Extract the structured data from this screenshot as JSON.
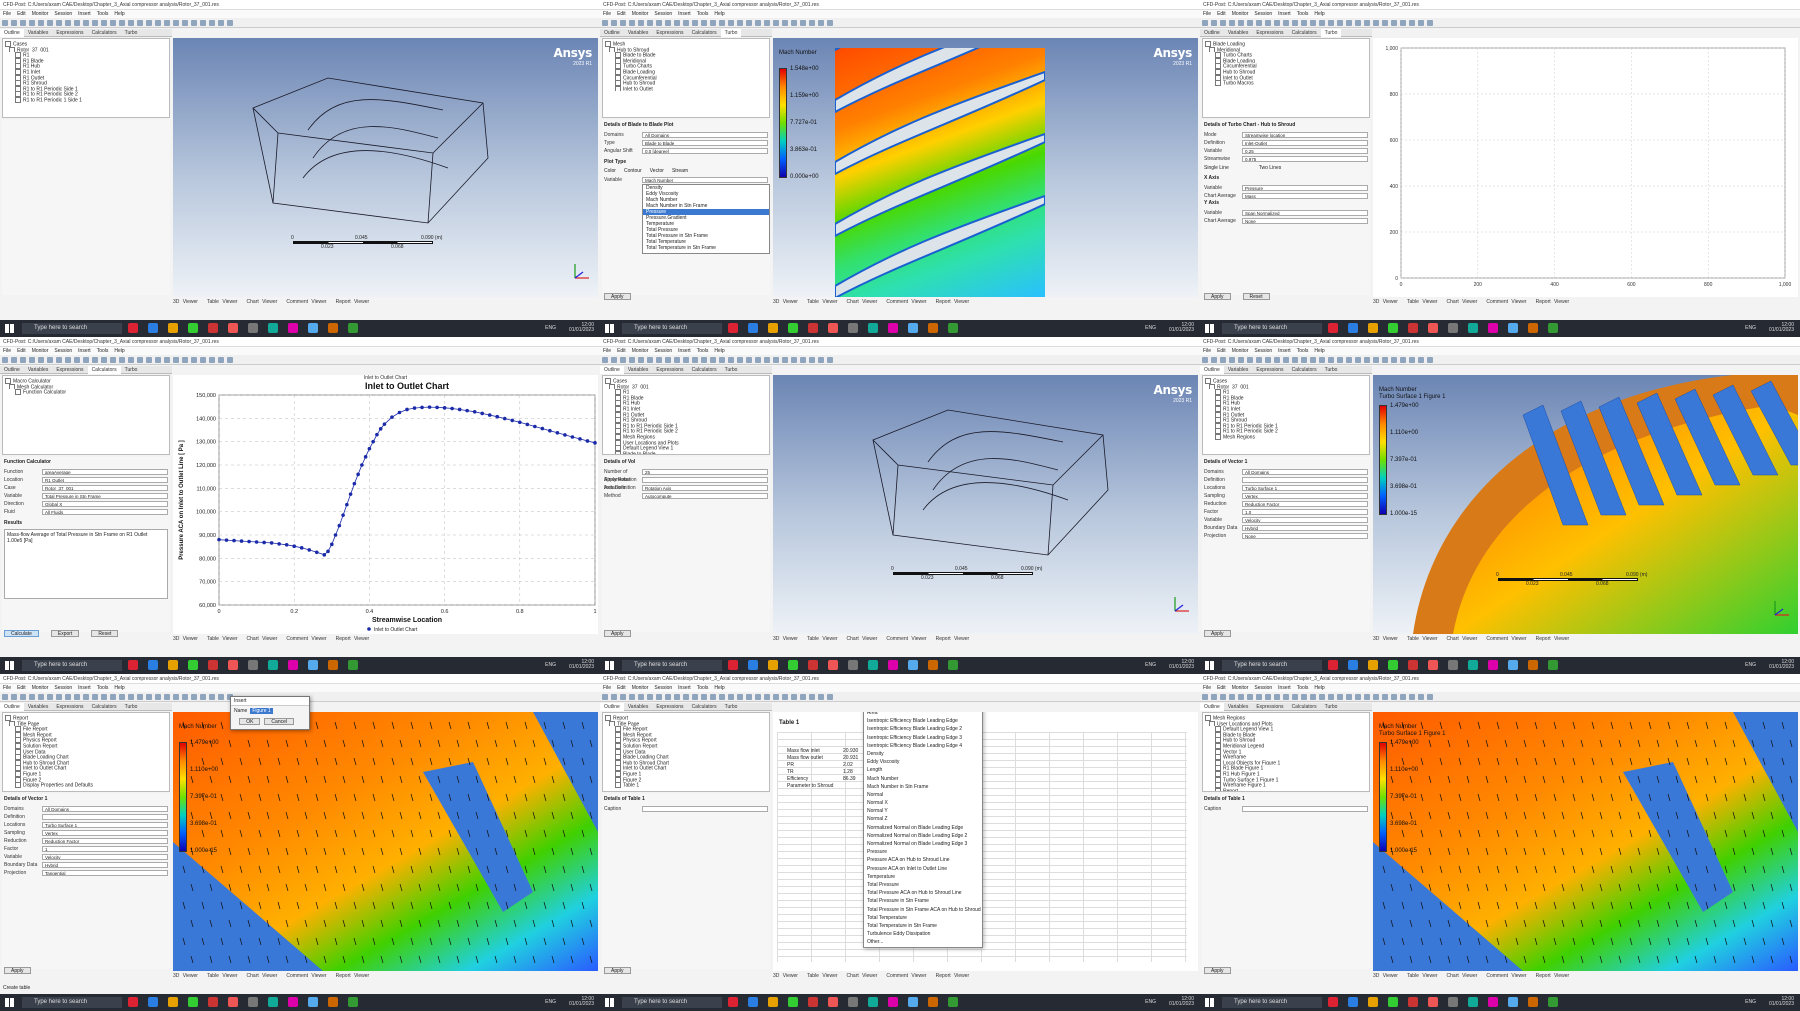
{
  "common": {
    "title": "CFD-Post: C:/Users/axam CAE/Desktop/Chapter_3_Axial compressor analysis/Rotor_37_001.res",
    "menu": [
      "File",
      "Edit",
      "Monitor",
      "Session",
      "Insert",
      "Tools",
      "Help"
    ],
    "tabs": [
      "Outline",
      "Variables",
      "Expressions",
      "Calculators",
      "Turbo"
    ],
    "bottom_tabs": [
      "3D Viewer",
      "Table Viewer",
      "Chart Viewer",
      "Comment Viewer",
      "Report Viewer"
    ],
    "brand": "Ansys",
    "release": "2023 R1",
    "view_label": "View 1",
    "taskbar_search": "Type here to search",
    "taskbar_tray": "ENG",
    "taskbar_time": "12:00",
    "taskbar_date": "01/01/2023",
    "scale": {
      "zero": "0",
      "mid": "0.045",
      "end": "0.090 (m)",
      "q1": "0.023",
      "q3": "0.068"
    }
  },
  "p1": {
    "tree": [
      "Cases",
      "Rotor_37_001",
      "R1",
      "R1 Blade",
      "R1 Hub",
      "R1 Inlet",
      "R1 Outlet",
      "R1 Shroud",
      "R1 to R1 Periodic Side 1",
      "R1 to R1 Periodic Side 2",
      "R1 to R1 Periodic 1 Side 1"
    ]
  },
  "p2": {
    "tree": [
      "Mesh",
      "Hub to Shroud",
      "Blade to Blade",
      "Meridional",
      "Turbo Charts",
      "Blade Loading",
      "Circumferential",
      "Hub to Shroud",
      "Inlet to Outlet"
    ],
    "details_title": "Details of Blade to Blade Plot",
    "rows": [
      [
        "Domains",
        "All Domains"
      ],
      [
        "Type",
        "Blade to Blade"
      ],
      [
        "Angular Shift",
        "0.0 [degree]"
      ]
    ],
    "plot_type_label": "Plot Type",
    "plot_types": [
      "Color",
      "Contour",
      "Vector",
      "Stream"
    ],
    "variable_label": "Variable",
    "variable_value": "Mach Number",
    "options": [
      "Density",
      "Eddy Viscosity",
      "Mach Number",
      "Mach Number in Stn Frame",
      "Pressure",
      "Pressure.Gradient",
      "Temperature",
      "Total Pressure",
      "Total Pressure in Stn Frame",
      "Total Temperature",
      "Total Temperature in Stn Frame"
    ],
    "selected": "Pressure",
    "cb_title": "Mach Number",
    "cb_values": [
      "1.548e+00",
      "1.159e+00",
      "7.727e-01",
      "3.863e-01",
      "0.000e+00"
    ],
    "apply": "Apply"
  },
  "p3": {
    "tree": [
      "Blade Loading",
      "Meridional",
      "Turbo Charts",
      "Blade Loading",
      "Circumferential",
      "Hub to Shroud",
      "Inlet to Outlet",
      "Turbo Macros"
    ],
    "details_title": "Details of Turbo Chart - Hub to Shroud",
    "mode": [
      "Single Line",
      "Two Lines"
    ],
    "rows": [
      [
        "Mode",
        "Streamwise location"
      ],
      [
        "Definition",
        "Inlet-Outlet"
      ],
      [
        "Variable",
        "0.25"
      ],
      [
        "Streamwise",
        "0.975"
      ]
    ],
    "x_label": "X Axis",
    "x_rows": [
      [
        "Variable",
        "Pressure"
      ],
      [
        "Chart Average",
        "Mass"
      ]
    ],
    "y_label": "Y Axis",
    "y_rows": [
      [
        "Variable",
        "Span Normalized"
      ],
      [
        "Chart Average",
        "None"
      ]
    ],
    "apply": "Apply",
    "reset": "Reset",
    "chart_data": {
      "type": "line",
      "yticks": [
        "1,000",
        "800",
        "600",
        "400",
        "200",
        "0"
      ],
      "xticks": [
        "0",
        "200",
        "400",
        "600",
        "800",
        "1,000"
      ],
      "xlim": [
        0,
        1000
      ],
      "ylim": [
        0,
        1000
      ]
    }
  },
  "p4": {
    "tree": [
      "Macro Calculator",
      "Mesh Calculator",
      "Function Calculator"
    ],
    "details_title": "Function Calculator",
    "rows": [
      [
        "Function",
        "areaAverage"
      ],
      [
        "Location",
        "R1 Outlet"
      ],
      [
        "Case",
        "Rotor_37_001"
      ],
      [
        "Variable",
        "Total Pressure in Stn Frame"
      ],
      [
        "Direction",
        "Global X"
      ],
      [
        "Fluid",
        "All Fluids"
      ]
    ],
    "results_label": "Results",
    "result_text": "Mass-flow Average of Total Pressure in Stn Frame on R1 Outlet",
    "result_value": "1.00e5 [Pa]",
    "buttons": [
      "Calculate",
      "Export",
      "Reset"
    ],
    "chart_title_small": "Inlet to Outlet Chart",
    "chart_data": {
      "type": "line",
      "title": "Inlet to Outlet Chart",
      "xlabel": "Streamwise Location",
      "ylabel": "Pressure ACA on Inlet to Outlet Line [ Pa ]",
      "legend": "Inlet to Outlet Chart",
      "xlim": [
        0,
        1
      ],
      "ylim": [
        60000,
        150000
      ],
      "xticks": [
        "0",
        "0.2",
        "0.4",
        "0.6",
        "0.8",
        "1"
      ],
      "yticks": [
        "150,000",
        "140,000",
        "130,000",
        "120,000",
        "110,000",
        "100,000",
        "90,000",
        "80,000",
        "70,000",
        "60,000"
      ],
      "x": [
        0.0,
        0.02,
        0.04,
        0.06,
        0.08,
        0.1,
        0.12,
        0.14,
        0.16,
        0.18,
        0.2,
        0.22,
        0.24,
        0.26,
        0.28,
        0.29,
        0.3,
        0.31,
        0.32,
        0.33,
        0.34,
        0.35,
        0.36,
        0.37,
        0.38,
        0.39,
        0.4,
        0.41,
        0.42,
        0.43,
        0.44,
        0.46,
        0.48,
        0.5,
        0.52,
        0.54,
        0.56,
        0.58,
        0.6,
        0.62,
        0.64,
        0.66,
        0.68,
        0.7,
        0.72,
        0.74,
        0.76,
        0.78,
        0.8,
        0.82,
        0.84,
        0.86,
        0.88,
        0.9,
        0.92,
        0.94,
        0.96,
        0.98,
        1.0
      ],
      "y": [
        88000,
        87800,
        87600,
        87400,
        87200,
        87000,
        86800,
        86600,
        86200,
        85800,
        85200,
        84500,
        83600,
        82600,
        81500,
        83000,
        86000,
        90000,
        94000,
        98500,
        103000,
        107500,
        112000,
        116000,
        120000,
        123500,
        127000,
        130000,
        133000,
        135500,
        137500,
        140500,
        142500,
        143800,
        144400,
        144700,
        144800,
        144700,
        144500,
        144200,
        143800,
        143300,
        142800,
        142100,
        141400,
        140700,
        139900,
        139100,
        138300,
        137400,
        136500,
        135600,
        134700,
        133800,
        132900,
        132000,
        131200,
        130300,
        129500
      ]
    }
  },
  "p5": {
    "tree": [
      "Cases",
      "Rotor_37_001",
      "R1",
      "R1 Blade",
      "R1 Hub",
      "R1 Inlet",
      "R1 Outlet",
      "R1 Shroud",
      "R1 to R1 Periodic Side 1",
      "R1 to R1 Periodic Side 2",
      "Mesh Regions",
      "User Locations and Plots",
      "Default Legend View 1",
      "Blade to Blade",
      "Meridional Legend",
      "Wireframe",
      "Report",
      "Title Page",
      "File Report"
    ],
    "details_title": "Details of Vol",
    "rows": [
      [
        "Number of Streamwise Instances",
        "25"
      ],
      [
        "Apply Rotation",
        ""
      ],
      [
        "Axis Definition",
        "Rotation Axis"
      ],
      [
        "Method",
        "Autocompute"
      ]
    ],
    "apply": "Apply"
  },
  "p6": {
    "tree": [
      "Cases",
      "Rotor_37_001",
      "R1",
      "R1 Blade",
      "R1 Hub",
      "R1 Inlet",
      "R1 Outlet",
      "R1 Shroud",
      "R1 to R1 Periodic Side 1",
      "R1 to R1 Periodic Side 2",
      "Mesh Regions"
    ],
    "details_title": "Details of Vector 1",
    "rows": [
      [
        "Domains",
        "All Domains"
      ],
      [
        "Definition",
        ""
      ],
      [
        "Locations",
        "Turbo Surface 1"
      ],
      [
        "Sampling",
        "Vertex"
      ],
      [
        "Reduction",
        "Reduction Factor"
      ],
      [
        "Factor",
        "1.0"
      ],
      [
        "Variable",
        "Velocity"
      ],
      [
        "Boundary Data",
        "Hybrid"
      ],
      [
        "Projection",
        "None"
      ]
    ],
    "cb_title": "Mach Number",
    "cb_sub": "Turbo Surface 1 Figure 1",
    "cb_values": [
      "1.479e+00",
      "1.110e+00",
      "7.397e-01",
      "3.698e-01",
      "1.000e-15"
    ],
    "apply": "Apply"
  },
  "p7": {
    "tree": [
      "Report",
      "Title Page",
      "File Report",
      "Mesh Report",
      "Physics Report",
      "Solution Report",
      "User Data",
      "Blade Loading Chart",
      "Hub to Shroud Chart",
      "Inlet to Outlet Chart",
      "Figure 1",
      "Figure 2",
      "Display Properties and Defaults"
    ],
    "details_title": "Details of Vector 1",
    "rows": [
      [
        "Domains",
        "All Domains"
      ],
      [
        "Definition",
        ""
      ],
      [
        "Locations",
        "Turbo Surface 1"
      ],
      [
        "Sampling",
        "Vertex"
      ],
      [
        "Reduction",
        "Reduction Factor"
      ],
      [
        "Factor",
        "1"
      ],
      [
        "Variable",
        "Velocity"
      ],
      [
        "Boundary Data",
        "Hybrid"
      ],
      [
        "Projection",
        "Tangential"
      ]
    ],
    "dialog_title": "Insert",
    "dialog_label": "Name",
    "dialog_value": "Figure 1",
    "dialog_ok": "OK",
    "dialog_cancel": "Cancel",
    "cb_title": "Mach Number",
    "cb_values": [
      "1.479e+00",
      "1.110e+00",
      "7.397e-01",
      "3.698e-01",
      "1.000e-15"
    ],
    "apply": "Apply",
    "status": "Create table"
  },
  "p8": {
    "tree": [
      "Report",
      "Title Page",
      "File Report",
      "Mesh Report",
      "Physics Report",
      "Solution Report",
      "User Data",
      "Blade Loading Chart",
      "Hub to Shroud Chart",
      "Inlet to Outlet Chart",
      "Figure 1",
      "Figure 2",
      "Table 1"
    ],
    "details_title": "Details of Table 1",
    "caption_label": "Caption",
    "table_title": "Table 1",
    "table_rows": [
      [
        "Mass flow inlet",
        "20.930"
      ],
      [
        "Mass flow outlet",
        "20.931"
      ],
      [
        "PR",
        "2.02"
      ],
      [
        "TR",
        "1.28"
      ],
      [
        "Efficiency",
        "86.39"
      ],
      [
        "Parameter to Shroud",
        ""
      ]
    ],
    "menu_items": [
      "Area",
      "Isentropic Efficiency Blade Leading Edge",
      "Isentropic Efficiency Blade Leading Edge 2",
      "Isentropic Efficiency Blade Leading Edge 3",
      "Isentropic Efficiency Blade Leading Edge 4",
      "Density",
      "Eddy Viscosity",
      "Length",
      "Mach Number",
      "Mach Number in Stn Frame",
      "Normal",
      "Normal X",
      "Normal Y",
      "Normal Z",
      "Normalized Normal on Blade Leading Edge",
      "Normalized Normal on Blade Leading Edge 2",
      "Normalized Normal on Blade Leading Edge 3",
      "Pressure",
      "Pressure ACA on Hub to Shroud Line",
      "Pressure ACA on Inlet to Outlet Line",
      "Temperature",
      "Total Pressure",
      "Total Pressure ACA on Hub to Shroud Line",
      "Total Pressure in Stn Frame",
      "Total Pressure in Stn Frame ACA on Hub to Shroud Line",
      "Total Temperature",
      "Total Temperature in Stn Frame",
      "Turbulence Eddy Dissipation",
      "Other..."
    ],
    "apply": "Apply"
  },
  "p9": {
    "tree": [
      "Mesh Regions",
      "User Locations and Plots",
      "Default Legend View 1",
      "Blade to Blade",
      "Hub to Shroud",
      "Meridional Legend",
      "Vector 1",
      "Wireframe",
      "Local Objects for Figure 1",
      "R1 Blade Figure 1",
      "R1 Hub Figure 1",
      "Turbo Surface 1 Figure 1",
      "Wireframe Figure 1",
      "Report",
      "Title Page",
      "File Report",
      "Mesh Report",
      "Physics Report",
      "Solution Report",
      "User Data",
      "Blade Loading Chart",
      "Hub to Shroud Chart",
      "Inlet to Outlet Chart"
    ],
    "details_title": "Details of Table 1",
    "caption_label": "Caption",
    "figure_label": "Figure 1",
    "cb_title": "Mach Number",
    "cb_sub": "Turbo Surface 1 Figure 1",
    "cb_values": [
      "1.479e+00",
      "1.110e+00",
      "7.397e-01",
      "3.698e-01",
      "1.000e-15"
    ],
    "apply": "Apply"
  }
}
